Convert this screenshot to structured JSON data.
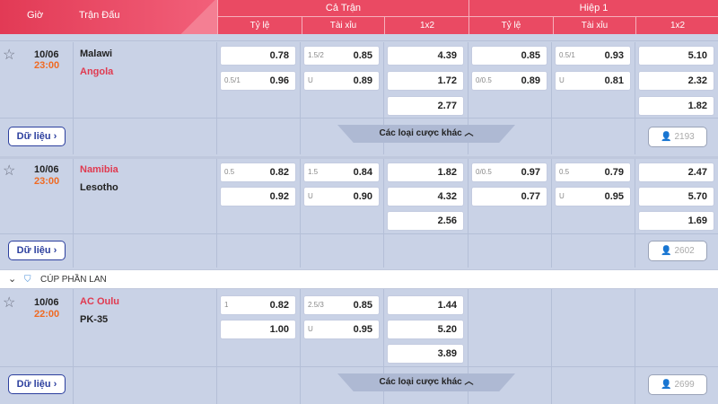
{
  "header": {
    "time_label": "Giờ",
    "match_label": "Trận Đấu",
    "full_match": "Cả Trận",
    "first_half": "Hiệp 1",
    "handicap": "Tỷ lệ",
    "over_under": "Tài xỉu",
    "one_x_two": "1x2"
  },
  "data_button_label": "Dữ liệu",
  "more_bets_label": "Các loại cược khác",
  "matches": [
    {
      "date": "10/06",
      "time": "23:00",
      "home": "Malawi",
      "away": "Angola",
      "ft_hdp": [
        {
          "hc": "",
          "odd": "0.78"
        },
        {
          "hc": "0.5/1",
          "odd": "0.96"
        }
      ],
      "ft_ou": [
        {
          "hc": "1.5/2",
          "odd": "0.85"
        },
        {
          "hc": "U",
          "odd": "0.89"
        }
      ],
      "ft_1x2": [
        "4.39",
        "1.72",
        "2.77"
      ],
      "h1_hdp": [
        {
          "hc": "",
          "odd": "0.85"
        },
        {
          "hc": "0/0.5",
          "odd": "0.89"
        }
      ],
      "h1_ou": [
        {
          "hc": "0.5/1",
          "odd": "0.93"
        },
        {
          "hc": "U",
          "odd": "0.81"
        }
      ],
      "h1_1x2": [
        "5.10",
        "2.32",
        "1.82"
      ],
      "views": "2193"
    },
    {
      "date": "10/06",
      "time": "23:00",
      "home": "Namibia",
      "away": "Lesotho",
      "ft_hdp": [
        {
          "hc": "0.5",
          "odd": "0.82"
        },
        {
          "hc": "",
          "odd": "0.92"
        }
      ],
      "ft_ou": [
        {
          "hc": "1.5",
          "odd": "0.84"
        },
        {
          "hc": "U",
          "odd": "0.90"
        }
      ],
      "ft_1x2": [
        "1.82",
        "4.32",
        "2.56"
      ],
      "h1_hdp": [
        {
          "hc": "0/0.5",
          "odd": "0.97"
        },
        {
          "hc": "",
          "odd": "0.77"
        }
      ],
      "h1_ou": [
        {
          "hc": "0.5",
          "odd": "0.79"
        },
        {
          "hc": "U",
          "odd": "0.95"
        }
      ],
      "h1_1x2": [
        "2.47",
        "5.70",
        "1.69"
      ],
      "views": "2602"
    },
    {
      "date": "10/06",
      "time": "22:00",
      "home": "AC Oulu",
      "away": "PK-35",
      "ft_hdp": [
        {
          "hc": "1",
          "odd": "0.82"
        },
        {
          "hc": "",
          "odd": "1.00"
        }
      ],
      "ft_ou": [
        {
          "hc": "2.5/3",
          "odd": "0.85"
        },
        {
          "hc": "U",
          "odd": "0.95"
        }
      ],
      "ft_1x2": [
        "1.44",
        "5.20",
        "3.89"
      ],
      "views": "2699"
    }
  ],
  "league": {
    "name": "CÚP PHẦN LAN"
  }
}
